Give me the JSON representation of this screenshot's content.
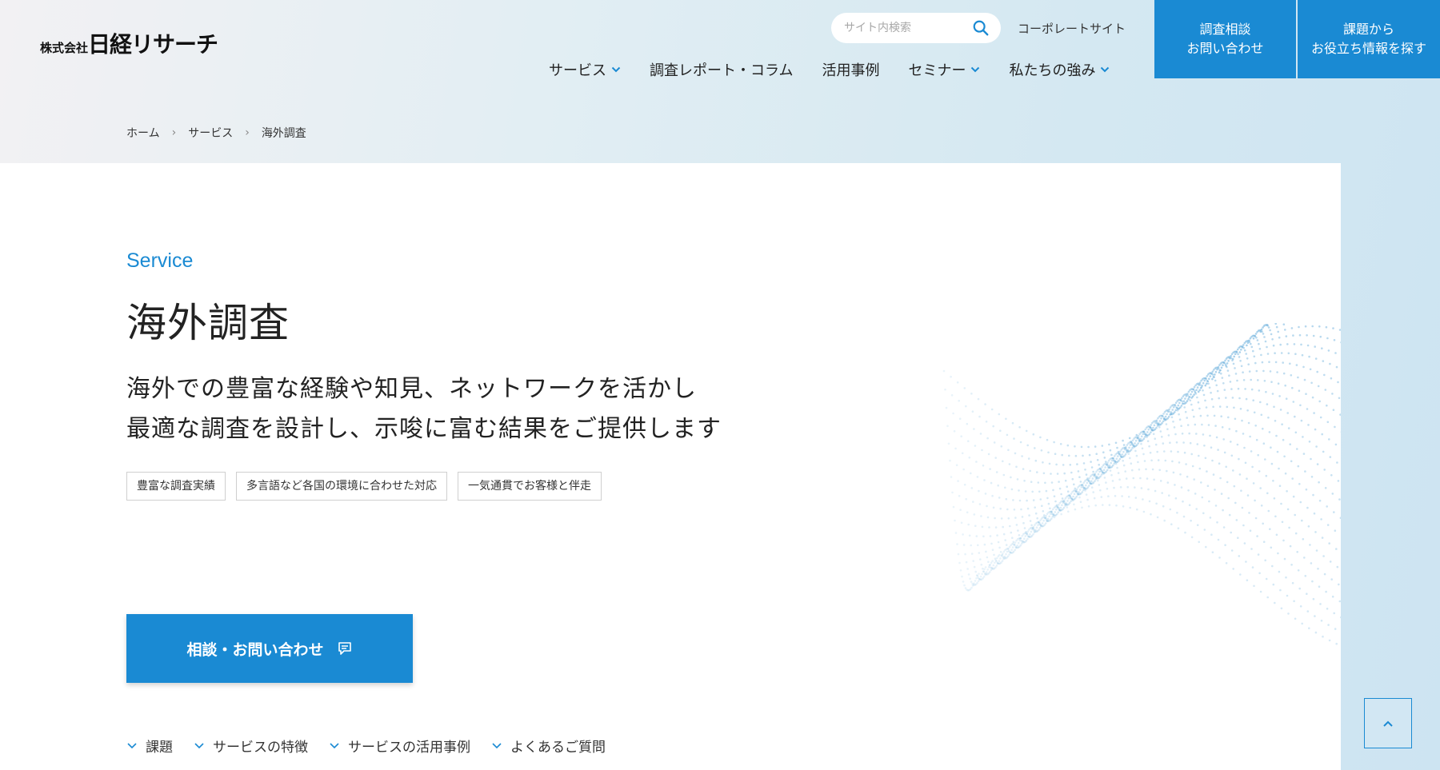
{
  "header": {
    "logo_prefix": "株式会社",
    "logo_main": "日経リサーチ",
    "search_placeholder": "サイト内検索",
    "corporate_link": "コーポレートサイト",
    "nav": [
      {
        "label": "サービス",
        "has_dropdown": true
      },
      {
        "label": "調査レポート・コラム",
        "has_dropdown": false
      },
      {
        "label": "活用事例",
        "has_dropdown": false
      },
      {
        "label": "セミナー",
        "has_dropdown": true
      },
      {
        "label": "私たちの強み",
        "has_dropdown": true
      }
    ],
    "cta_consult": {
      "line1": "調査相談",
      "line2": "お問い合わせ"
    },
    "cta_info": {
      "line1": "課題から",
      "line2": "お役立ち情報を探す"
    }
  },
  "breadcrumb": [
    "ホーム",
    "サービス",
    "海外調査"
  ],
  "main": {
    "eyebrow": "Service",
    "title": "海外調査",
    "lead_line1": "海外での豊富な経験や知見、ネットワークを活かし",
    "lead_line2": "最適な調査を設計し、示唆に富む結果をご提供します",
    "tags": [
      "豊富な調査実績",
      "多言語など各国の環境に合わせた対応",
      "一気通貫でお客様と伴走"
    ],
    "contact_button": "相談・お問い合わせ",
    "anchors": [
      "課題",
      "サービスの特徴",
      "サービスの活用事例",
      "よくあるご質問"
    ]
  },
  "colors": {
    "accent": "#1a8ad3",
    "text": "#222222"
  },
  "icons": {
    "search": "search-icon",
    "chat": "chat-icon",
    "dropdown": "chevron-down-icon",
    "to_top": "chevron-up-icon"
  }
}
